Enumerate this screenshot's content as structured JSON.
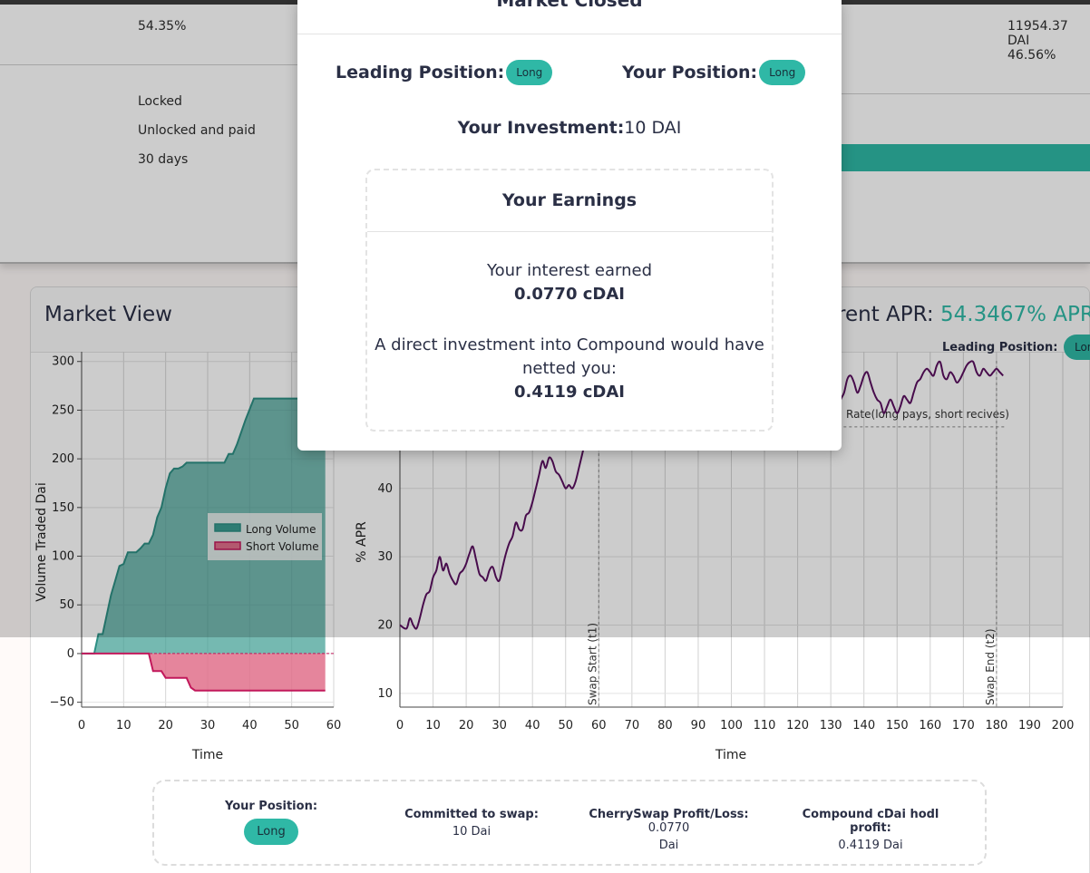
{
  "top_card": {
    "left_values": [
      "54.35%",
      "Locked",
      "Unlocked and paid",
      "30 days"
    ],
    "right_values": [
      "11954.37 DAI",
      "46.56%"
    ]
  },
  "market_view": {
    "title": "Market View",
    "apr_label": "rrent APR: ",
    "apr_value": "54.3467% APR",
    "leading_label": "Leading Position:",
    "leading_value": "Long"
  },
  "volume_chart": {
    "type": "area",
    "xlabel": "Time",
    "ylabel": "Volume Traded Dai",
    "xlim": [
      0,
      60
    ],
    "ylim": [
      -55,
      310
    ],
    "xticks": [
      0,
      10,
      20,
      30,
      40,
      50,
      60
    ],
    "yticks": [
      -50,
      0,
      50,
      100,
      150,
      200,
      250,
      300
    ],
    "legend": [
      "Long Volume",
      "Short Volume"
    ],
    "long_color": "#3a9b90",
    "short_color": "#e0708b",
    "long_volume": [
      [
        0,
        0
      ],
      [
        3,
        0
      ],
      [
        4,
        20
      ],
      [
        5,
        20
      ],
      [
        6,
        40
      ],
      [
        7,
        60
      ],
      [
        8,
        75
      ],
      [
        9,
        90
      ],
      [
        10,
        92
      ],
      [
        11,
        104
      ],
      [
        13,
        104
      ],
      [
        14,
        108
      ],
      [
        15,
        113
      ],
      [
        16,
        113
      ],
      [
        17,
        122
      ],
      [
        18,
        140
      ],
      [
        19,
        150
      ],
      [
        20,
        170
      ],
      [
        21,
        185
      ],
      [
        22,
        190
      ],
      [
        23,
        190
      ],
      [
        24,
        192
      ],
      [
        25,
        196
      ],
      [
        34,
        196
      ],
      [
        35,
        205
      ],
      [
        36,
        205
      ],
      [
        37,
        215
      ],
      [
        39,
        240
      ],
      [
        41,
        262
      ],
      [
        58,
        262
      ]
    ],
    "short_volume": [
      [
        0,
        0
      ],
      [
        16,
        0
      ],
      [
        17,
        -18
      ],
      [
        19,
        -18
      ],
      [
        20,
        -25
      ],
      [
        25,
        -25
      ],
      [
        26,
        -35
      ],
      [
        27,
        -38
      ],
      [
        58,
        -38
      ]
    ]
  },
  "apr_chart": {
    "type": "line",
    "xlabel": "Time",
    "ylabel": "% APR",
    "xlim": [
      0,
      200
    ],
    "ylim": [
      8,
      60
    ],
    "xticks": [
      0,
      10,
      20,
      30,
      40,
      50,
      60,
      70,
      80,
      90,
      100,
      110,
      120,
      130,
      140,
      150,
      160,
      170,
      180,
      190,
      200
    ],
    "yticks": [
      10,
      20,
      30,
      40
    ],
    "swap_start": 60,
    "swap_start_label": "Swap Start (t1)",
    "swap_end": 180,
    "swap_end_label": "Swap End (t2)",
    "rate_level": 49,
    "rate_label": "Rate(long pays, short recives)",
    "line_color": "#5a1060",
    "apr": [
      [
        0,
        20
      ],
      [
        2,
        19.5
      ],
      [
        3,
        21
      ],
      [
        4,
        20
      ],
      [
        5,
        19.5
      ],
      [
        6,
        21
      ],
      [
        7,
        23
      ],
      [
        8,
        24.5
      ],
      [
        9,
        25
      ],
      [
        10,
        27
      ],
      [
        11,
        28
      ],
      [
        12,
        30
      ],
      [
        13,
        28
      ],
      [
        14,
        29
      ],
      [
        15,
        27.5
      ],
      [
        16,
        26.5
      ],
      [
        17,
        26
      ],
      [
        18,
        27.5
      ],
      [
        19,
        28
      ],
      [
        20,
        29
      ],
      [
        21,
        30.5
      ],
      [
        22,
        31.5
      ],
      [
        23,
        29.5
      ],
      [
        24,
        27.5
      ],
      [
        25,
        27
      ],
      [
        26,
        26.5
      ],
      [
        27,
        28
      ],
      [
        28,
        28.5
      ],
      [
        29,
        27
      ],
      [
        30,
        26.5
      ],
      [
        31,
        28.5
      ],
      [
        32,
        30.5
      ],
      [
        33,
        32
      ],
      [
        34,
        33
      ],
      [
        35,
        35
      ],
      [
        36,
        34
      ],
      [
        37,
        34
      ],
      [
        38,
        36
      ],
      [
        39,
        36.5
      ],
      [
        40,
        38
      ],
      [
        41,
        40
      ],
      [
        42,
        42
      ],
      [
        43,
        44
      ],
      [
        44,
        43
      ],
      [
        45,
        44.5
      ],
      [
        46,
        44
      ],
      [
        47,
        42.5
      ],
      [
        48,
        42
      ],
      [
        49,
        41
      ],
      [
        50,
        40
      ],
      [
        51,
        40.5
      ],
      [
        52,
        40
      ],
      [
        53,
        41
      ],
      [
        54,
        43
      ],
      [
        55,
        45
      ],
      [
        56,
        47
      ],
      [
        57,
        48
      ],
      [
        58,
        49
      ],
      [
        59,
        48
      ],
      [
        60,
        49.5
      ],
      [
        62,
        50.5
      ],
      [
        64,
        51
      ],
      [
        66,
        50
      ],
      [
        68,
        49
      ],
      [
        70,
        50
      ],
      [
        72,
        51
      ],
      [
        74,
        50.5
      ],
      [
        76,
        49.5
      ],
      [
        78,
        50.5
      ],
      [
        80,
        51
      ],
      [
        82,
        50
      ],
      [
        84,
        50.5
      ],
      [
        86,
        51
      ],
      [
        88,
        49.5
      ],
      [
        90,
        50.5
      ],
      [
        92,
        51
      ],
      [
        94,
        50
      ],
      [
        96,
        51
      ],
      [
        98,
        50.5
      ],
      [
        100,
        48.5
      ],
      [
        101,
        49.5
      ],
      [
        102,
        51
      ],
      [
        104,
        50
      ],
      [
        106,
        51
      ],
      [
        108,
        50.5
      ],
      [
        110,
        51
      ],
      [
        112,
        50
      ],
      [
        114,
        51
      ],
      [
        116,
        50.5
      ],
      [
        118,
        51
      ],
      [
        120,
        50
      ],
      [
        122,
        51
      ],
      [
        124,
        52
      ],
      [
        126,
        53
      ],
      [
        128,
        53.5
      ],
      [
        130,
        51.5
      ],
      [
        131,
        51
      ],
      [
        132,
        51.5
      ],
      [
        133,
        53
      ],
      [
        134,
        54
      ],
      [
        135,
        56
      ],
      [
        136,
        56.5
      ],
      [
        137,
        55.5
      ],
      [
        138,
        54
      ],
      [
        139,
        55
      ],
      [
        140,
        56.5
      ],
      [
        141,
        57
      ],
      [
        142,
        55.5
      ],
      [
        143,
        54
      ],
      [
        144,
        53
      ],
      [
        145,
        52.5
      ],
      [
        146,
        51
      ],
      [
        147,
        52
      ],
      [
        148,
        53
      ],
      [
        149,
        52
      ],
      [
        150,
        51
      ],
      [
        151,
        52
      ],
      [
        152,
        53.5
      ],
      [
        153,
        53
      ],
      [
        154,
        52.5
      ],
      [
        155,
        54
      ],
      [
        156,
        55.5
      ],
      [
        157,
        56
      ],
      [
        158,
        57
      ],
      [
        159,
        57.5
      ],
      [
        160,
        57
      ],
      [
        161,
        56.5
      ],
      [
        162,
        58
      ],
      [
        163,
        58.5
      ],
      [
        164,
        56.5
      ],
      [
        165,
        56
      ],
      [
        166,
        57
      ],
      [
        167,
        56.5
      ],
      [
        168,
        55.5
      ],
      [
        169,
        56
      ],
      [
        170,
        57
      ],
      [
        171,
        58
      ],
      [
        172,
        58.5
      ],
      [
        173,
        58.5
      ],
      [
        174,
        57
      ],
      [
        175,
        56.5
      ],
      [
        176,
        57.5
      ],
      [
        177,
        57
      ],
      [
        178,
        56.5
      ],
      [
        179,
        57
      ],
      [
        180,
        57.5
      ],
      [
        181,
        57
      ],
      [
        182,
        56.5
      ]
    ]
  },
  "summary": {
    "position_label": "Your Position:",
    "position_value": "Long",
    "committed_label": "Committed to swap:",
    "committed_value": "10 Dai",
    "profit_label": "CherrySwap Profit/Loss:",
    "profit_value": " 0.0770",
    "profit_unit": "Dai",
    "hodl_label": "Compound cDai hodl profit:",
    "hodl_value": "0.4119 Dai"
  },
  "modal": {
    "title": "Market Closed",
    "leading_label": "Leading Position:",
    "leading_value": "Long",
    "your_position_label": "Your Position:",
    "your_position_value": "Long",
    "investment_label": "Your Investment:",
    "investment_value": "10 DAI",
    "earnings_title": "Your Earnings",
    "interest_label": "Your interest earned",
    "interest_value": "0.0770 cDAI",
    "compound_line1": "A direct investment into Compound would have",
    "compound_line2": "netted you:",
    "compound_value": "0.4119 cDAI"
  },
  "colors": {
    "accent": "#2fb8a6",
    "text": "#2a2f45"
  }
}
